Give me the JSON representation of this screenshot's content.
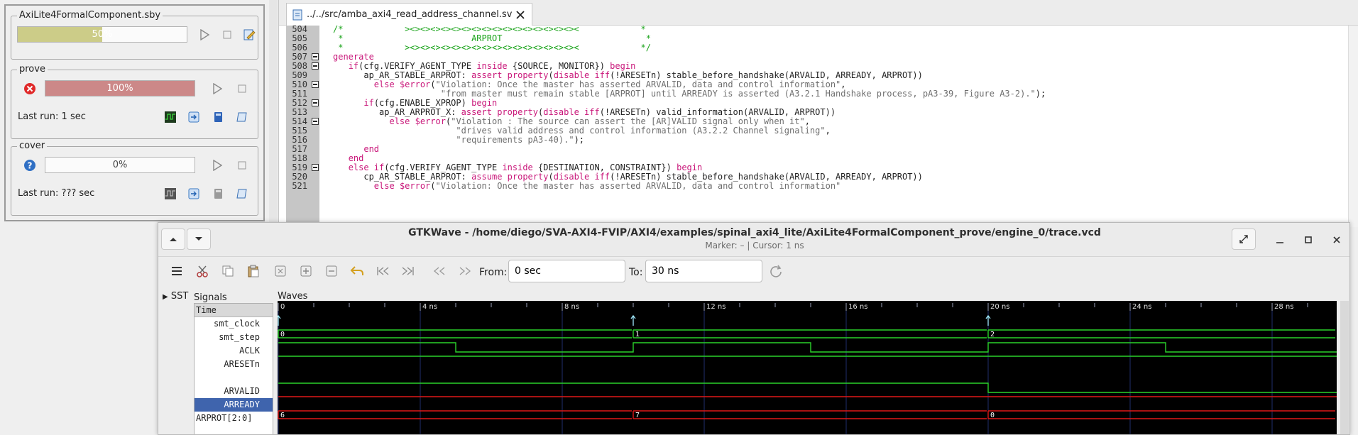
{
  "sby": {
    "file": "AxiLite4FormalComponent.sby",
    "overall_progress": "50%",
    "overall_value": 0.5,
    "tasks": [
      {
        "name": "prove",
        "progress": "100%",
        "value": 1.0,
        "status_icon": "error-x-icon",
        "last_run": "Last run: 1 sec"
      },
      {
        "name": "cover",
        "progress": "0%",
        "value": 0.0,
        "status_icon": "question-icon",
        "last_run": "Last run: ??? sec"
      }
    ]
  },
  "editor": {
    "tab_label": "../../src/amba_axi4_read_address_channel.sv",
    "lines": [
      {
        "n": "504",
        "fold": false,
        "segs": [
          [
            "c",
            "/*            ><><><><><><><><><><><><><><><><><            *"
          ]
        ]
      },
      {
        "n": "505",
        "fold": false,
        "segs": [
          [
            "c",
            " *                         ARPROT                            *"
          ]
        ]
      },
      {
        "n": "506",
        "fold": false,
        "segs": [
          [
            "c",
            " *            ><><><><><><><><><><><><><><><><><            */"
          ]
        ]
      },
      {
        "n": "507",
        "fold": true,
        "segs": [
          [
            "k",
            "generate"
          ]
        ]
      },
      {
        "n": "508",
        "fold": true,
        "segs": [
          [
            "p",
            "   "
          ],
          [
            "k",
            "if"
          ],
          [
            "p",
            "(cfg.VERIFY_AGENT_TYPE "
          ],
          [
            "k",
            "inside"
          ],
          [
            "p",
            " {SOURCE, MONITOR}) "
          ],
          [
            "k",
            "begin"
          ]
        ]
      },
      {
        "n": "509",
        "fold": false,
        "segs": [
          [
            "p",
            "      ap_AR_STABLE_ARPROT: "
          ],
          [
            "k",
            "assert property"
          ],
          [
            "p",
            "("
          ],
          [
            "k",
            "disable iff"
          ],
          [
            "p",
            "(!ARESETn) stable_before_handshake(ARVALID, ARREADY, ARPROT))"
          ]
        ]
      },
      {
        "n": "510",
        "fold": true,
        "segs": [
          [
            "p",
            "        "
          ],
          [
            "k",
            "else"
          ],
          [
            "p",
            " "
          ],
          [
            "k",
            "$error"
          ],
          [
            "p",
            "("
          ],
          [
            "s",
            "\"Violation: Once the master has asserted ARVALID, data and control information\""
          ],
          [
            "p",
            ","
          ]
        ]
      },
      {
        "n": "511",
        "fold": false,
        "segs": [
          [
            "p",
            "                     "
          ],
          [
            "s",
            "\"from master must remain stable [ARPROT] until ARREADY is asserted (A3.2.1 Handshake process, pA3-39, Figure A3-2).\""
          ],
          [
            "p",
            ");"
          ]
        ]
      },
      {
        "n": "512",
        "fold": true,
        "segs": [
          [
            "p",
            "      "
          ],
          [
            "k",
            "if"
          ],
          [
            "p",
            "(cfg.ENABLE_XPROP) "
          ],
          [
            "k",
            "begin"
          ]
        ]
      },
      {
        "n": "513",
        "fold": false,
        "segs": [
          [
            "p",
            "         ap_AR_ARPROT_X: "
          ],
          [
            "k",
            "assert property"
          ],
          [
            "p",
            "("
          ],
          [
            "k",
            "disable iff"
          ],
          [
            "p",
            "(!ARESETn) valid_information(ARVALID, ARPROT))"
          ]
        ]
      },
      {
        "n": "514",
        "fold": true,
        "segs": [
          [
            "p",
            "           "
          ],
          [
            "k",
            "else"
          ],
          [
            "p",
            " "
          ],
          [
            "k",
            "$error"
          ],
          [
            "p",
            "("
          ],
          [
            "s",
            "\"Violation : The source can assert the [AR]VALID signal only when it\""
          ],
          [
            "p",
            ","
          ]
        ]
      },
      {
        "n": "515",
        "fold": false,
        "segs": [
          [
            "p",
            "                        "
          ],
          [
            "s",
            "\"drives valid address and control information (A3.2.2 Channel signaling\""
          ],
          [
            "p",
            ","
          ]
        ]
      },
      {
        "n": "516",
        "fold": false,
        "segs": [
          [
            "p",
            "                        "
          ],
          [
            "s",
            "\"requirements pA3-40).\""
          ],
          [
            "p",
            ");"
          ]
        ]
      },
      {
        "n": "517",
        "fold": false,
        "segs": [
          [
            "p",
            "      "
          ],
          [
            "k",
            "end"
          ]
        ]
      },
      {
        "n": "518",
        "fold": false,
        "segs": [
          [
            "p",
            "   "
          ],
          [
            "k",
            "end"
          ]
        ]
      },
      {
        "n": "519",
        "fold": true,
        "segs": [
          [
            "p",
            "   "
          ],
          [
            "k",
            "else if"
          ],
          [
            "p",
            "(cfg.VERIFY_AGENT_TYPE "
          ],
          [
            "k",
            "inside"
          ],
          [
            "p",
            " {DESTINATION, CONSTRAINT}) "
          ],
          [
            "k",
            "begin"
          ]
        ]
      },
      {
        "n": "520",
        "fold": false,
        "segs": [
          [
            "p",
            "      cp_AR_STABLE_ARPROT: "
          ],
          [
            "k",
            "assume property"
          ],
          [
            "p",
            "("
          ],
          [
            "k",
            "disable iff"
          ],
          [
            "p",
            "(!ARESETn) stable_before_handshake(ARVALID, ARREADY, ARPROT))"
          ]
        ]
      },
      {
        "n": "521",
        "fold": false,
        "segs": [
          [
            "p",
            "        "
          ],
          [
            "k",
            "else"
          ],
          [
            "p",
            " "
          ],
          [
            "k",
            "$error"
          ],
          [
            "p",
            "("
          ],
          [
            "s",
            "\"Violation: Once the master has asserted ARVALID, data and control information\""
          ]
        ]
      }
    ]
  },
  "gtkwave": {
    "title": "GTKWave - /home/diego/SVA-AXI4-FVIP/AXI4/examples/spinal_axi4_lite/AxiLite4FormalComponent_prove/engine_0/trace.vcd",
    "subtitle": "Marker: –  |  Cursor: 1 ns",
    "from_label": "From:",
    "from_value": "0 sec",
    "to_label": "To:",
    "to_value": "30 ns",
    "sst_label": "SST",
    "signals_label": "Signals",
    "waves_label": "Waves",
    "signals": [
      "Time",
      "smt_clock",
      "smt_step",
      "ACLK",
      "ARESETn",
      "",
      "ARVALID",
      "ARREADY",
      "ARPROT[2:0]"
    ],
    "selected_signal": "ARREADY",
    "time_ticks": [
      "0",
      "4 ns",
      "8 ns",
      "12 ns",
      "16 ns",
      "20 ns",
      "24 ns",
      "28 ns"
    ],
    "smt_step_values": [
      "0",
      "1",
      "2"
    ],
    "arprot_values": [
      "6",
      "7",
      "0"
    ]
  },
  "colors": {
    "wave_bg": "#000000",
    "wave_green": "#2ad22a",
    "wave_red": "#e01818",
    "grid": "#1f2e6b",
    "keyword": "#c9177a",
    "comment": "#1aa31a",
    "string": "#6e6e6e",
    "progress_olive": "#cccc88",
    "progress_red": "#cc8888",
    "selection": "#3f64ad"
  }
}
